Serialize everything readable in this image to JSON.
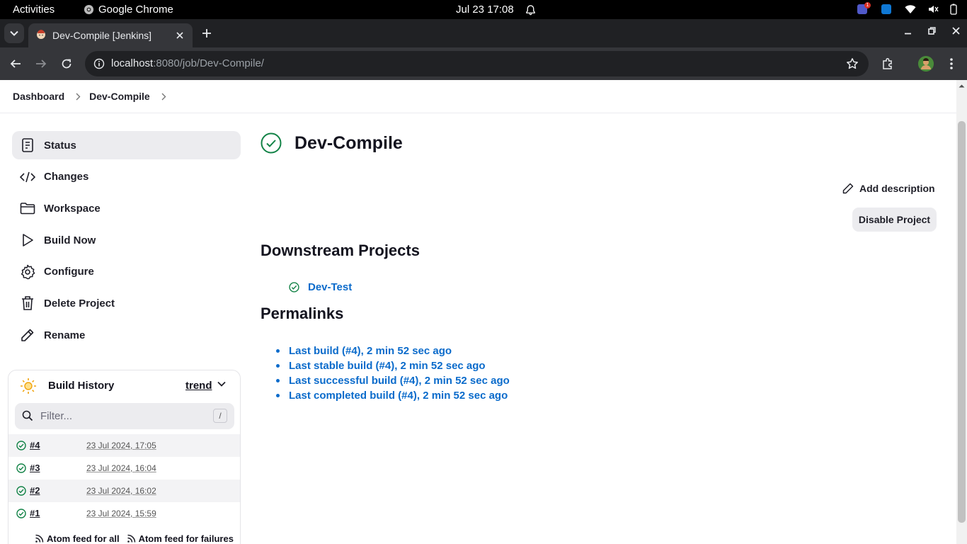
{
  "os": {
    "activities": "Activities",
    "app_name": "Google Chrome",
    "clock": "Jul 23  17:08",
    "teams_badge": "1"
  },
  "browser": {
    "tab_title": "Dev-Compile [Jenkins]",
    "url_host": "localhost",
    "url_path": ":8080/job/Dev-Compile/"
  },
  "breadcrumb": [
    "Dashboard",
    "Dev-Compile"
  ],
  "sidebar": {
    "items": [
      {
        "label": "Status",
        "icon": "status-icon",
        "active": true
      },
      {
        "label": "Changes",
        "icon": "code-icon"
      },
      {
        "label": "Workspace",
        "icon": "folder-icon"
      },
      {
        "label": "Build Now",
        "icon": "play-icon"
      },
      {
        "label": "Configure",
        "icon": "gear-icon"
      },
      {
        "label": "Delete Project",
        "icon": "trash-icon"
      },
      {
        "label": "Rename",
        "icon": "pencil-icon"
      }
    ]
  },
  "build_history": {
    "title": "Build History",
    "trend_label": "trend",
    "filter_placeholder": "Filter...",
    "filter_shortcut": "/",
    "builds": [
      {
        "number": "#4",
        "date": "23 Jul 2024, 17:05"
      },
      {
        "number": "#3",
        "date": "23 Jul 2024, 16:04"
      },
      {
        "number": "#2",
        "date": "23 Jul 2024, 16:02"
      },
      {
        "number": "#1",
        "date": "23 Jul 2024, 15:59"
      }
    ],
    "feed_all": "Atom feed for all",
    "feed_failures": "Atom feed for failures"
  },
  "main": {
    "title": "Dev-Compile",
    "add_description": "Add description",
    "disable_project": "Disable Project",
    "downstream_heading": "Downstream Projects",
    "downstream": [
      "Dev-Test"
    ],
    "permalinks_heading": "Permalinks",
    "permalinks": [
      "Last build (#4), 2 min 52 sec ago",
      "Last stable build (#4), 2 min 52 sec ago",
      "Last successful build (#4), 2 min 52 sec ago",
      "Last completed build (#4), 2 min 52 sec ago"
    ]
  },
  "colors": {
    "success": "#138347",
    "link": "#0b6bcb",
    "chrome_dark": "#202124",
    "chrome_toolbar": "#35363a"
  }
}
